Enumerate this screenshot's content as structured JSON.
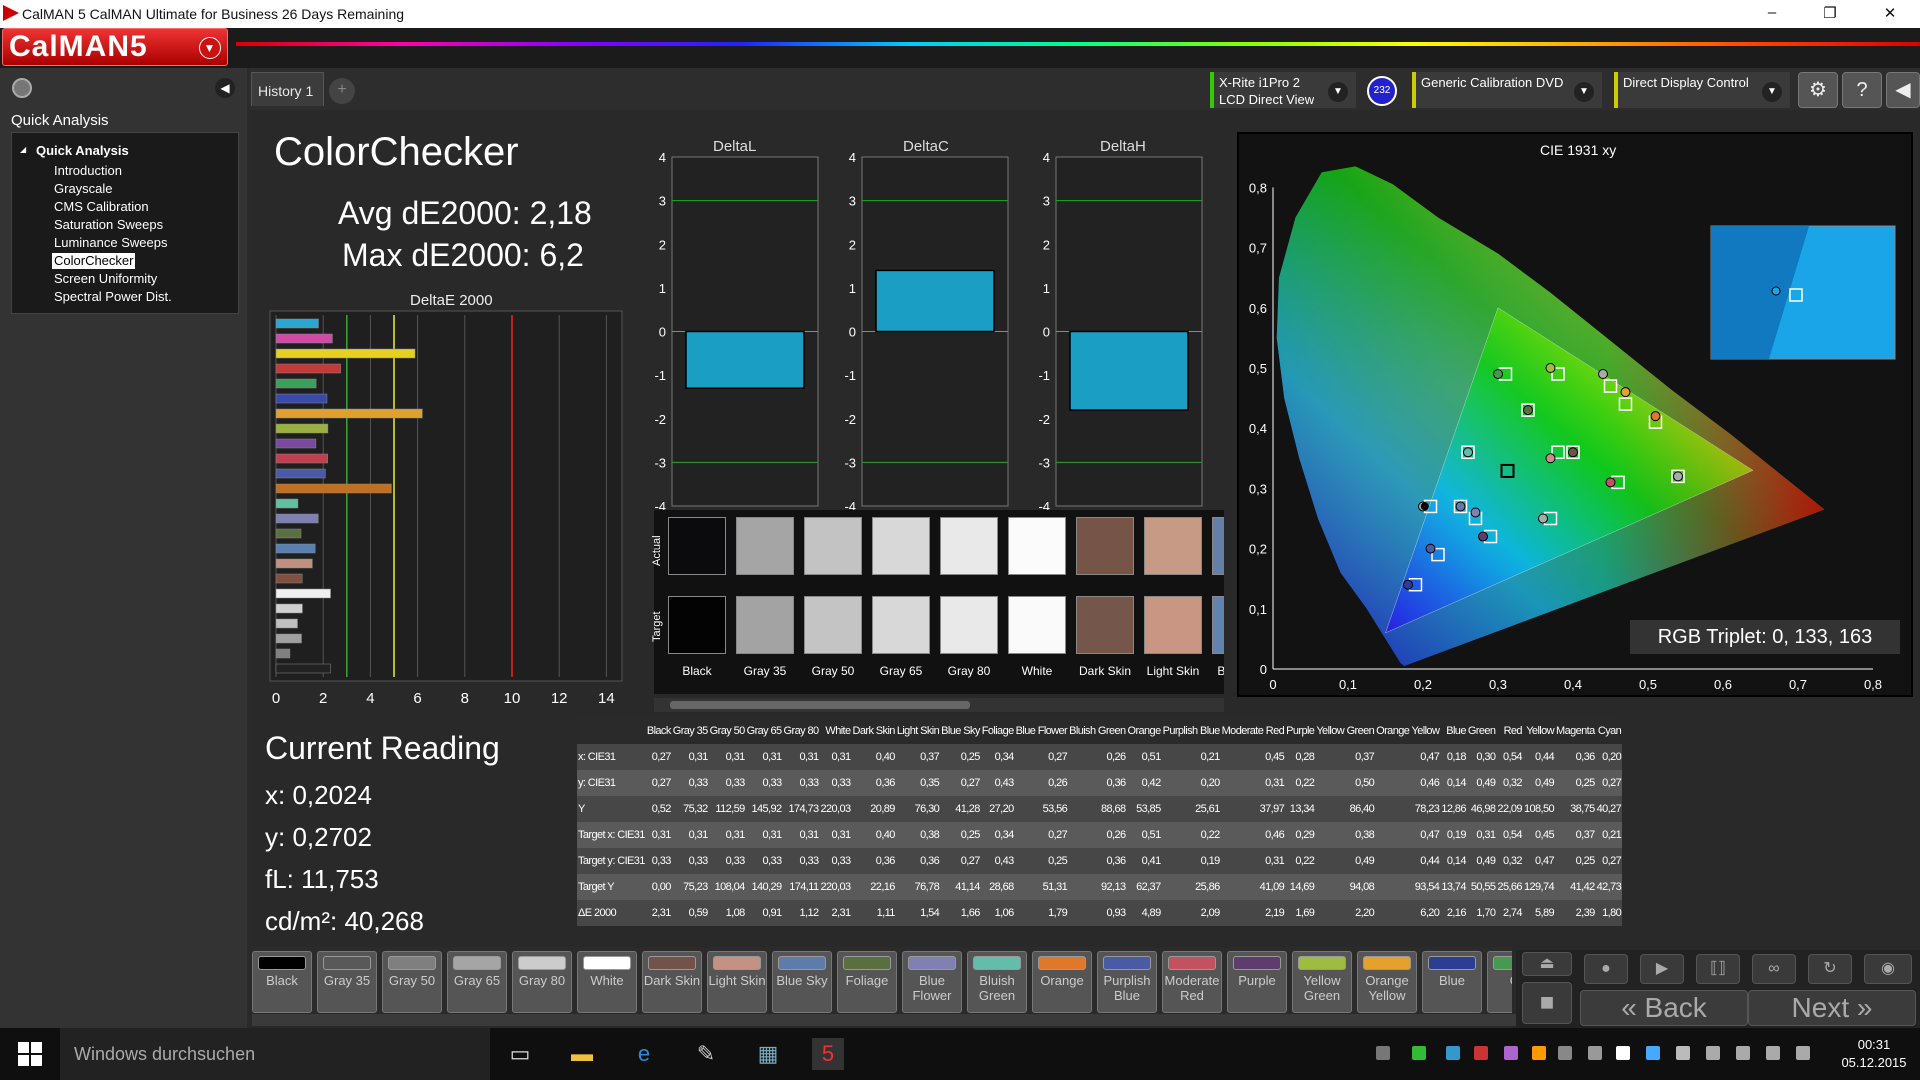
{
  "window": {
    "title": "CalMAN 5 CalMAN Ultimate for Business 26 Days Remaining"
  },
  "app": {
    "logo": "CalMAN5"
  },
  "sidebar": {
    "header": "Quick Analysis",
    "root": "Quick Analysis",
    "items": [
      "Introduction",
      "Grayscale",
      "CMS Calibration",
      "Saturation Sweeps",
      "Luminance Sweeps",
      "ColorChecker",
      "Screen Uniformity",
      "Spectral Power Dist."
    ],
    "selected": "ColorChecker"
  },
  "tabs": {
    "history": "History 1",
    "add": "+"
  },
  "devices": {
    "meter_line1": "X-Rite i1Pro 2",
    "meter_line2": "LCD Direct View",
    "meter_badge": "232",
    "source": "Generic Calibration DVD",
    "display": "Direct Display Control"
  },
  "header": {
    "title": "ColorChecker",
    "avg": "Avg dE2000: 2,18",
    "max": "Max dE2000: 6,2"
  },
  "deltaE": {
    "title": "DeltaE 2000",
    "ticks": [
      "0",
      "2",
      "4",
      "6",
      "8",
      "10",
      "12",
      "14"
    ]
  },
  "small_multiples": [
    {
      "title": "DeltaL",
      "value": -1.3
    },
    {
      "title": "DeltaC",
      "value": 1.4
    },
    {
      "title": "DeltaH",
      "value": -1.8
    }
  ],
  "small_ticks": [
    "4",
    "3",
    "2",
    "1",
    "0",
    "-1",
    "-2",
    "-3",
    "-4"
  ],
  "swatches": {
    "actual_label": "Actual",
    "target_label": "Target",
    "items": [
      {
        "name": "Black",
        "actual": "#0b0b0e",
        "target": "#030303"
      },
      {
        "name": "Gray 35",
        "actual": "#a5a5a5",
        "target": "#a3a3a3"
      },
      {
        "name": "Gray 50",
        "actual": "#c3c3c3",
        "target": "#c4c4c4"
      },
      {
        "name": "Gray 65",
        "actual": "#d8d8d8",
        "target": "#d8d8d8"
      },
      {
        "name": "Gray 80",
        "actual": "#e9e9e9",
        "target": "#e9e9e9"
      },
      {
        "name": "White",
        "actual": "#fbfbfb",
        "target": "#fafafa"
      },
      {
        "name": "Dark Skin",
        "actual": "#765447",
        "target": "#74564a"
      },
      {
        "name": "Light Skin",
        "actual": "#c79a86",
        "target": "#c99683"
      },
      {
        "name": "Blue Sky",
        "actual": "#6580a8",
        "target": "#6282b0"
      }
    ]
  },
  "cie": {
    "title": "CIE 1931 xy",
    "x_ticks": [
      "0",
      "0,1",
      "0,2",
      "0,3",
      "0,4",
      "0,5",
      "0,6",
      "0,7",
      "0,8"
    ],
    "y_ticks": [
      "0,8",
      "0,7",
      "0,6",
      "0,5",
      "0,4",
      "0,3",
      "0,2",
      "0,1",
      "0"
    ],
    "rgb_triplet": "RGB Triplet: 0, 133, 163"
  },
  "current": {
    "title": "Current Reading",
    "x": "x: 0,2024",
    "y": "y: 0,2702",
    "fl": "fL: 11,753",
    "cdm": "cd/m²: 40,268"
  },
  "table": {
    "columns": [
      "",
      "Black",
      "Gray 35",
      "Gray 50",
      "Gray 65",
      "Gray 80",
      "White",
      "Dark Skin",
      "Light Skin",
      "Blue Sky",
      "Foliage",
      "Blue Flower",
      "Bluish Green",
      "Orange",
      "Purplish Blue",
      "Moderate Red",
      "Purple",
      "Yellow Green",
      "Orange Yellow",
      "Blue",
      "Green",
      "Red",
      "Yellow",
      "Magenta",
      "Cyan"
    ],
    "rows": [
      [
        "x: CIE31",
        "0,27",
        "0,31",
        "0,31",
        "0,31",
        "0,31",
        "0,31",
        "0,40",
        "0,37",
        "0,25",
        "0,34",
        "0,27",
        "0,26",
        "0,51",
        "0,21",
        "0,45",
        "0,28",
        "0,37",
        "0,47",
        "0,18",
        "0,30",
        "0,54",
        "0,44",
        "0,36",
        "0,20"
      ],
      [
        "y: CIE31",
        "0,27",
        "0,33",
        "0,33",
        "0,33",
        "0,33",
        "0,33",
        "0,36",
        "0,35",
        "0,27",
        "0,43",
        "0,26",
        "0,36",
        "0,42",
        "0,20",
        "0,31",
        "0,22",
        "0,50",
        "0,46",
        "0,14",
        "0,49",
        "0,32",
        "0,49",
        "0,25",
        "0,27"
      ],
      [
        "Y",
        "0,52",
        "75,32",
        "112,59",
        "145,92",
        "174,73",
        "220,03",
        "20,89",
        "76,30",
        "41,28",
        "27,20",
        "53,56",
        "88,68",
        "53,85",
        "25,61",
        "37,97",
        "13,34",
        "86,40",
        "78,23",
        "12,86",
        "46,98",
        "22,09",
        "108,50",
        "38,75",
        "40,27"
      ],
      [
        "Target x: CIE31",
        "0,31",
        "0,31",
        "0,31",
        "0,31",
        "0,31",
        "0,31",
        "0,40",
        "0,38",
        "0,25",
        "0,34",
        "0,27",
        "0,26",
        "0,51",
        "0,22",
        "0,46",
        "0,29",
        "0,38",
        "0,47",
        "0,19",
        "0,31",
        "0,54",
        "0,45",
        "0,37",
        "0,21"
      ],
      [
        "Target y: CIE31",
        "0,33",
        "0,33",
        "0,33",
        "0,33",
        "0,33",
        "0,33",
        "0,36",
        "0,36",
        "0,27",
        "0,43",
        "0,25",
        "0,36",
        "0,41",
        "0,19",
        "0,31",
        "0,22",
        "0,49",
        "0,44",
        "0,14",
        "0,49",
        "0,32",
        "0,47",
        "0,25",
        "0,27"
      ],
      [
        "Target Y",
        "0,00",
        "75,23",
        "108,04",
        "140,29",
        "174,11",
        "220,03",
        "22,16",
        "76,78",
        "41,14",
        "28,68",
        "51,31",
        "92,13",
        "62,37",
        "25,86",
        "41,09",
        "14,69",
        "94,08",
        "93,54",
        "13,74",
        "50,55",
        "25,66",
        "129,74",
        "41,42",
        "42,73"
      ],
      [
        "ΔE 2000",
        "2,31",
        "0,59",
        "1,08",
        "0,91",
        "1,12",
        "2,31",
        "1,11",
        "1,54",
        "1,66",
        "1,06",
        "1,79",
        "0,93",
        "4,89",
        "2,09",
        "2,19",
        "1,69",
        "2,20",
        "6,20",
        "2,16",
        "1,70",
        "2,74",
        "5,89",
        "2,39",
        "1,80"
      ]
    ]
  },
  "strip": [
    {
      "l1": "Black",
      "l2": "",
      "c": "#000000"
    },
    {
      "l1": "Gray 35",
      "l2": "",
      "c": "#595959"
    },
    {
      "l1": "Gray 50",
      "l2": "",
      "c": "#7f7f7f"
    },
    {
      "l1": "Gray 65",
      "l2": "",
      "c": "#a5a5a5"
    },
    {
      "l1": "Gray 80",
      "l2": "",
      "c": "#cccccc"
    },
    {
      "l1": "White",
      "l2": "",
      "c": "#ffffff"
    },
    {
      "l1": "Dark Skin",
      "l2": "",
      "c": "#73524a"
    },
    {
      "l1": "Light Skin",
      "l2": "",
      "c": "#c49283"
    },
    {
      "l1": "Blue Sky",
      "l2": "",
      "c": "#5e7ca9"
    },
    {
      "l1": "Foliage",
      "l2": "",
      "c": "#5a6f3f"
    },
    {
      "l1": "Blue",
      "l2": "Flower",
      "c": "#8180b3"
    },
    {
      "l1": "Bluish",
      "l2": "Green",
      "c": "#63bdaa"
    },
    {
      "l1": "Orange",
      "l2": "",
      "c": "#e0782c"
    },
    {
      "l1": "Purplish",
      "l2": "Blue",
      "c": "#4a5ba6"
    },
    {
      "l1": "Moderate",
      "l2": "Red",
      "c": "#c2525f"
    },
    {
      "l1": "Purple",
      "l2": "",
      "c": "#5e3c6d"
    },
    {
      "l1": "Yellow",
      "l2": "Green",
      "c": "#9dbc40"
    },
    {
      "l1": "Orange",
      "l2": "Yellow",
      "c": "#e4a12e"
    },
    {
      "l1": "Blue",
      "l2": "",
      "c": "#2c3e93"
    },
    {
      "l1": "Gr",
      "l2": "",
      "c": "#459950"
    }
  ],
  "controls": {
    "back": "Back",
    "next": "Next"
  },
  "taskbar": {
    "search": "Windows durchsuchen",
    "time": "00:31",
    "date": "05.12.2015"
  }
}
